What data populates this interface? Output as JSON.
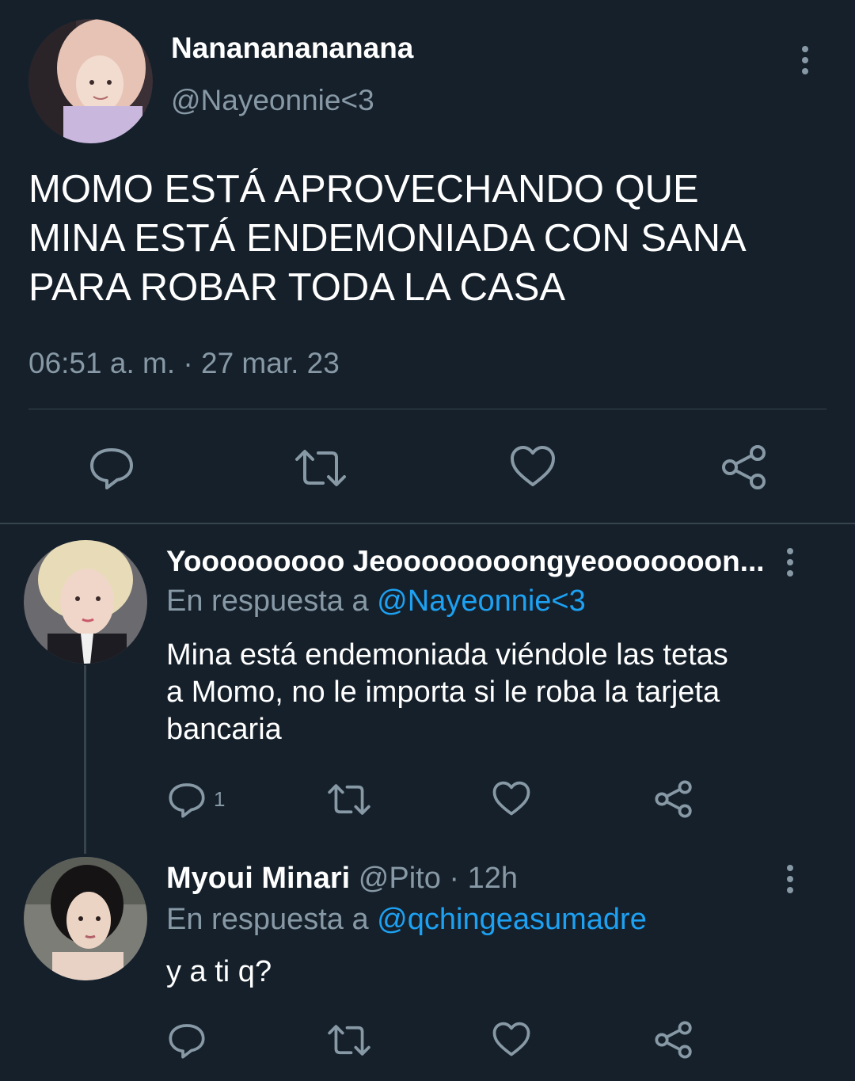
{
  "main_tweet": {
    "display_name": "Nanananananana",
    "handle": "@Nayeonnie<3",
    "text_lines": [
      "MOMO ESTÁ APROVECHANDO QUE",
      "MINA ESTÁ ENDEMONIADA CON SANA",
      "PARA ROBAR TODA LA CASA"
    ],
    "timestamp": "06:51 a. m. · 27 mar. 23",
    "actions": [
      "reply-icon",
      "retweet-icon",
      "like-icon",
      "share-icon"
    ]
  },
  "replies": [
    {
      "display_name": "Yooooooooo Jeoooooooongyeooooooon...",
      "reply_prefix": "En respuesta a",
      "reply_to": "@Nayeonnie<3",
      "text_lines": [
        "Mina está endemoniada viéndole las tetas",
        "a Momo, no le importa si le roba la tarjeta",
        "bancaria"
      ],
      "reply_count": "1"
    },
    {
      "display_name": "Myoui Minari",
      "handle": "@Pito",
      "time": "· 12h",
      "reply_prefix": "En respuesta a",
      "reply_to": "@qchingeasumadre",
      "text_lines": [
        "y a ti q?"
      ]
    }
  ],
  "colors": {
    "background": "#15202b",
    "muted": "#8899a6",
    "link": "#1da1f2",
    "divider": "#38444d"
  }
}
